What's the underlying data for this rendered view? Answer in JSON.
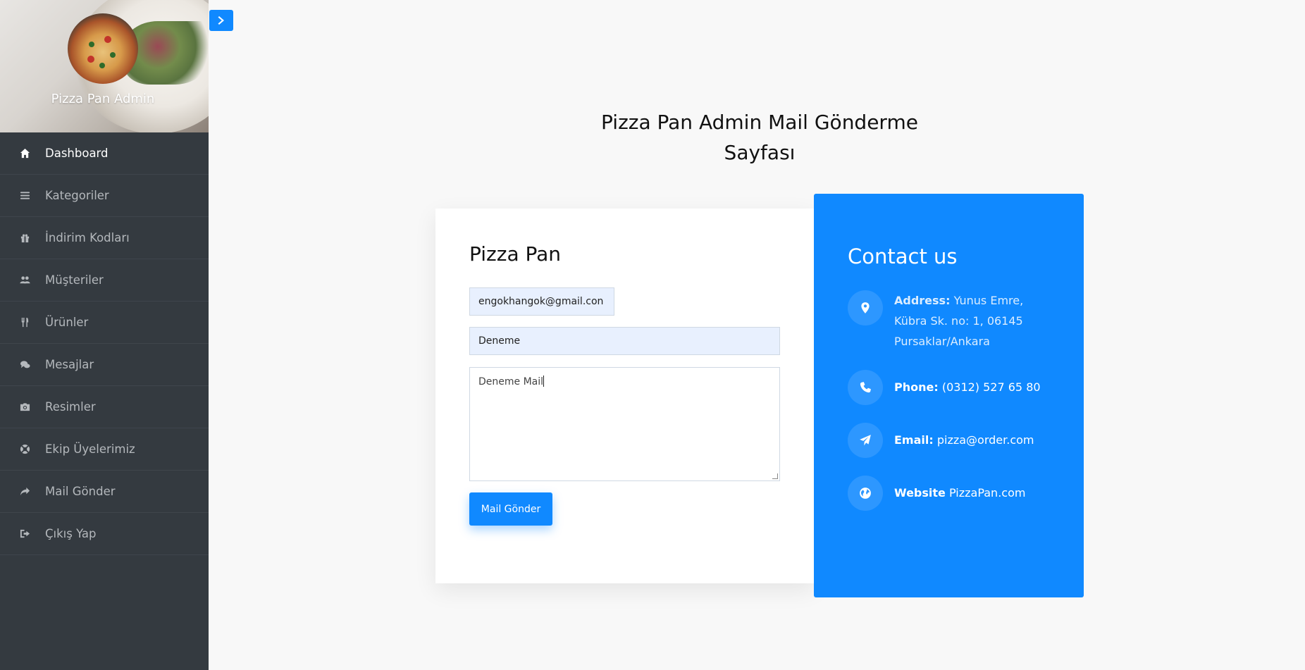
{
  "sidebar": {
    "brand": "Pizza Pan Admin",
    "items": [
      {
        "label": "Dashboard",
        "icon": "home-icon"
      },
      {
        "label": "Kategoriler",
        "icon": "list-icon"
      },
      {
        "label": "İndirim Kodları",
        "icon": "gift-icon"
      },
      {
        "label": "Müşteriler",
        "icon": "users-icon"
      },
      {
        "label": "Ürünler",
        "icon": "cutlery-icon"
      },
      {
        "label": "Mesajlar",
        "icon": "comments-icon"
      },
      {
        "label": "Resimler",
        "icon": "camera-icon"
      },
      {
        "label": "Ekip Üyelerimiz",
        "icon": "lifebuoy-icon"
      },
      {
        "label": "Mail Gönder",
        "icon": "share-icon"
      },
      {
        "label": "Çıkış Yap",
        "icon": "sign-out-icon"
      }
    ]
  },
  "page": {
    "title_line1": "Pizza Pan Admin Mail Gönderme",
    "title_line2": "Sayfası"
  },
  "form": {
    "title": "Pizza Pan",
    "email_value": "engokhangok@gmail.con",
    "subject_value": "Deneme",
    "message_value": "Deneme Mail",
    "submit_label": "Mail Gönder"
  },
  "contact": {
    "title": "Contact us",
    "address_label": "Address:",
    "address_value_line1": " Yunus Emre,",
    "address_value_line2": "Kübra Sk. no: 1, 06145",
    "address_value_line3": "Pursaklar/Ankara",
    "phone_label": "Phone:",
    "phone_value": " (0312) 527 65 80",
    "email_label": "Email:",
    "email_value": " pizza@order.com",
    "website_label": "Website",
    "website_value": " PizzaPan.com"
  },
  "colors": {
    "accent": "#1089ff",
    "sidebar_bg": "#343a40",
    "page_bg": "#f8f8f8"
  }
}
